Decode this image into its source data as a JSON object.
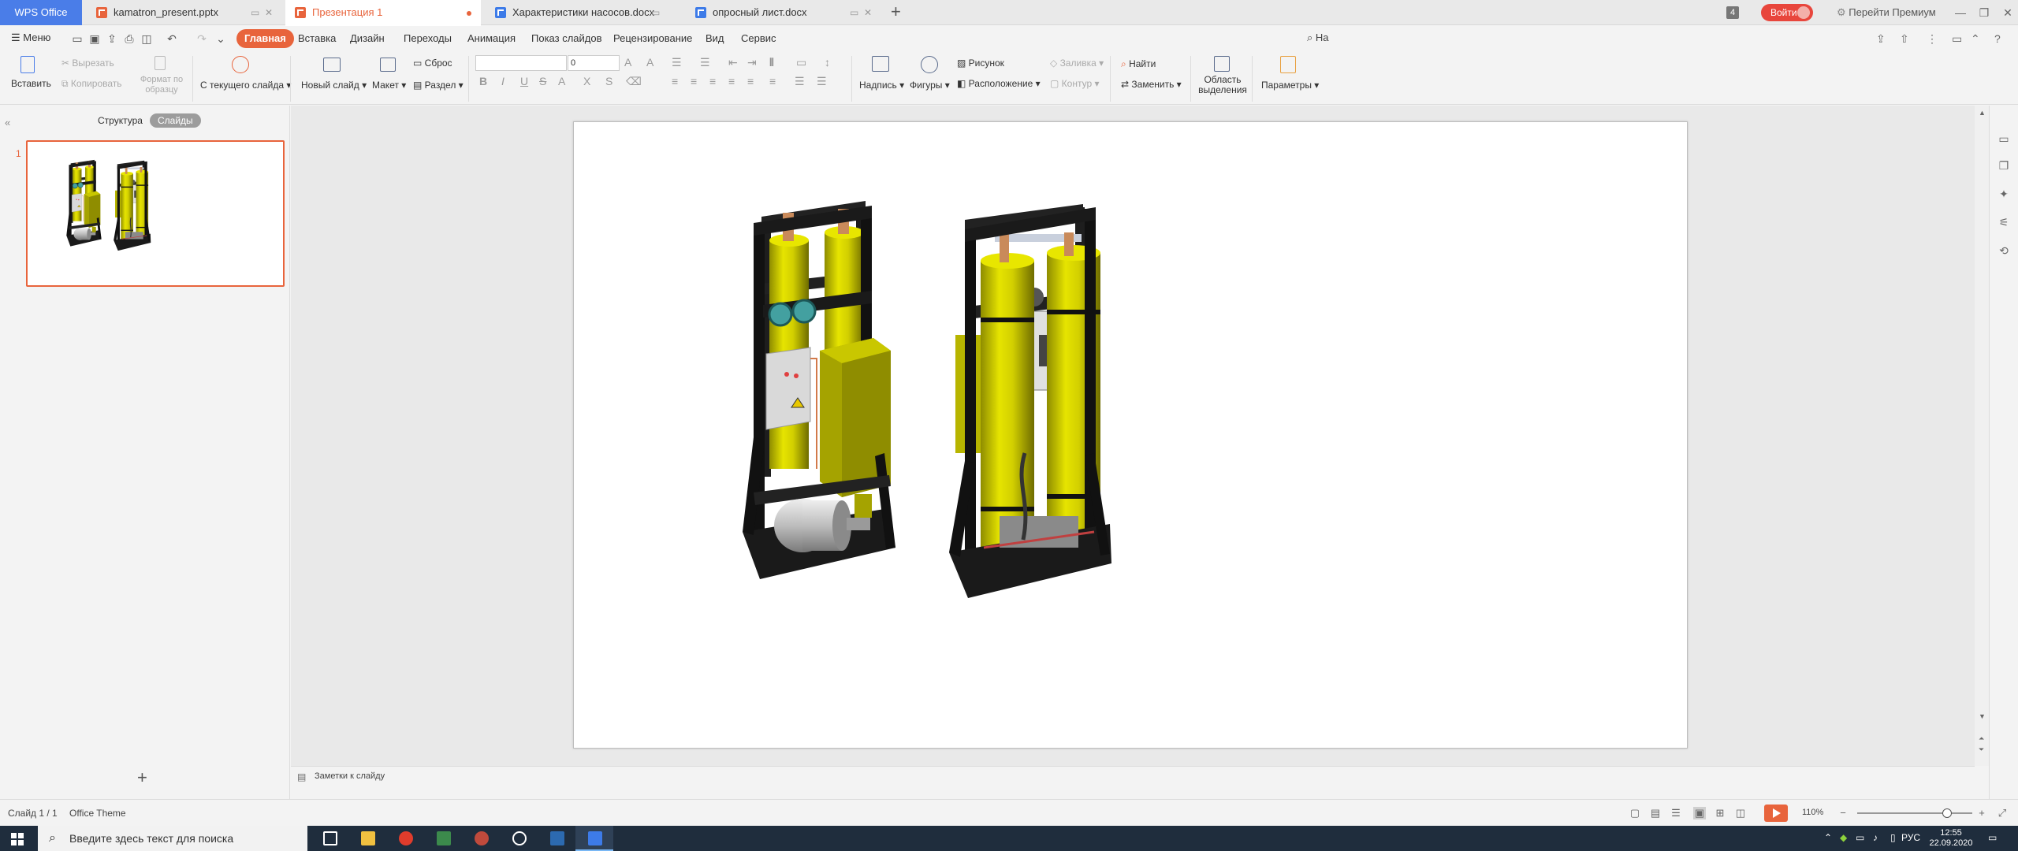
{
  "titlebar": {
    "brand": "WPS Office",
    "tabs": [
      {
        "label": "kamatron_present.pptx",
        "type": "ppt"
      },
      {
        "label": "Презентация 1",
        "type": "ppt",
        "active": true
      },
      {
        "label": "Характеристики насосов.docx",
        "type": "doc"
      },
      {
        "label": "опросный лист.docx",
        "type": "doc"
      }
    ],
    "window_count": "4",
    "login_label": "Войти",
    "premium_label": "Перейти Премиум"
  },
  "menu": {
    "menu_label": "Меню",
    "tabs": [
      "Главная",
      "Вставка",
      "Дизайн",
      "Переходы",
      "Анимация",
      "Показ слайдов",
      "Рецензирование",
      "Вид",
      "Сервис"
    ],
    "active_tab": "Главная",
    "search_label": "На"
  },
  "ribbon": {
    "paste": "Вставить",
    "cut": "Вырезать",
    "copy": "Копировать",
    "format_painter": "Формат по образцу",
    "from_current": "С текущего слайда",
    "new_slide": "Новый слайд",
    "layout": "Макет",
    "reset": "Сброс",
    "section": "Раздел",
    "font_size": "0",
    "textbox": "Надпись",
    "shapes": "Фигуры",
    "picture": "Рисунок",
    "arrange": "Расположение",
    "fill": "Заливка",
    "outline": "Контур",
    "find": "Найти",
    "replace": "Заменить",
    "selection_pane": "Область выделения",
    "options": "Параметры"
  },
  "leftpanel": {
    "tab_outline": "Структура",
    "tab_slides": "Слайды",
    "slide_number": "1"
  },
  "notes": {
    "placeholder": "Заметки к слайду"
  },
  "statusbar": {
    "slide_info": "Слайд 1 / 1",
    "theme": "Office Theme",
    "zoom": "110%",
    "zoom_fraction": 0.78
  },
  "taskbar": {
    "search_placeholder": "Введите здесь текст для поиска",
    "lang": "РУС",
    "time": "12:55",
    "date": "22.09.2020"
  },
  "colors": {
    "accent": "#e8643c",
    "brand": "#4a7de8",
    "machine_yellow": "#d8d400",
    "frame": "#1e1e1e"
  }
}
